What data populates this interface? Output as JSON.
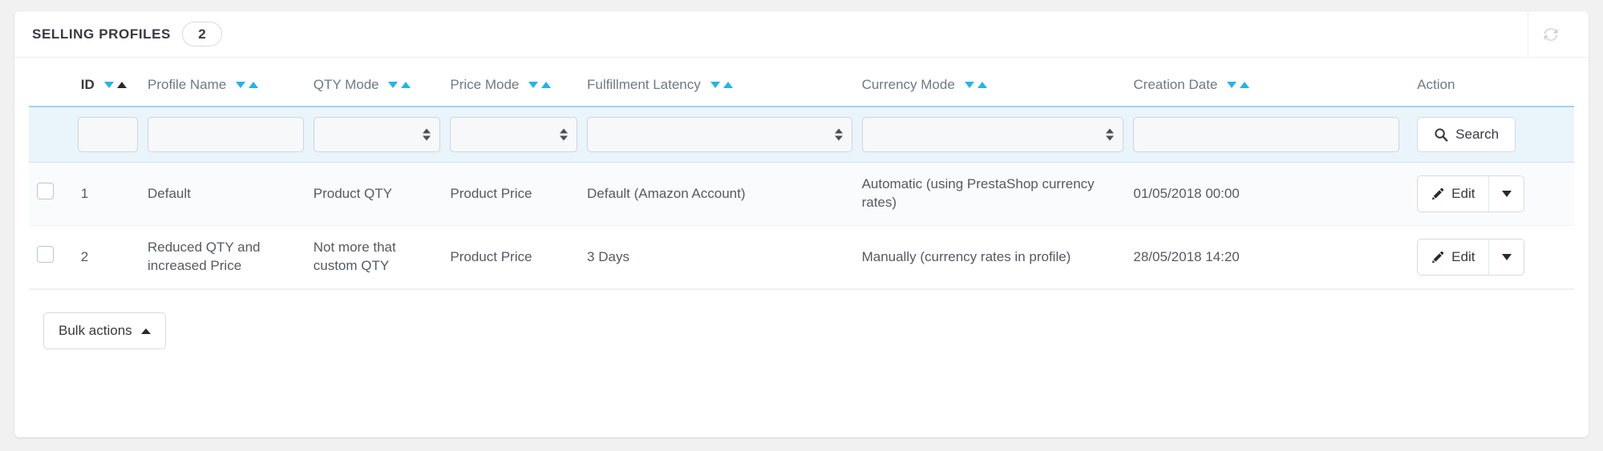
{
  "panel": {
    "title": "SELLING PROFILES",
    "count": "2",
    "refresh_icon": "refresh-icon"
  },
  "table": {
    "columns": [
      {
        "key": "checkbox",
        "label": "",
        "sortable": false
      },
      {
        "key": "id",
        "label": "ID",
        "sortable": true,
        "active_sort": "asc"
      },
      {
        "key": "profile_name",
        "label": "Profile Name",
        "sortable": true
      },
      {
        "key": "qty_mode",
        "label": "QTY Mode",
        "sortable": true
      },
      {
        "key": "price_mode",
        "label": "Price Mode",
        "sortable": true
      },
      {
        "key": "fulfillment_latency",
        "label": "Fulfillment Latency",
        "sortable": true
      },
      {
        "key": "currency_mode",
        "label": "Currency Mode",
        "sortable": true
      },
      {
        "key": "creation_date",
        "label": "Creation Date",
        "sortable": true
      },
      {
        "key": "action",
        "label": "Action",
        "sortable": false
      }
    ],
    "filters": {
      "id": {
        "type": "text",
        "value": "",
        "placeholder": ""
      },
      "profile_name": {
        "type": "text",
        "value": "",
        "placeholder": ""
      },
      "qty_mode": {
        "type": "select",
        "value": "",
        "options": [
          "",
          "Product QTY",
          "Not more that custom QTY"
        ]
      },
      "price_mode": {
        "type": "select",
        "value": "",
        "options": [
          "",
          "Product Price"
        ]
      },
      "fulfillment_latency": {
        "type": "select",
        "value": "",
        "options": [
          "",
          "Default (Amazon Account)",
          "3 Days"
        ]
      },
      "currency_mode": {
        "type": "select",
        "value": "",
        "options": [
          "",
          "Automatic (using PrestaShop currency rates)",
          "Manually (currency rates in profile)"
        ]
      },
      "creation_date": {
        "type": "text",
        "value": "",
        "placeholder": ""
      },
      "search_label": "Search",
      "search_icon": "search-icon"
    },
    "rows": [
      {
        "selected": false,
        "id": "1",
        "profile_name": "Default",
        "qty_mode": "Product QTY",
        "price_mode": "Product Price",
        "fulfillment_latency": "Default (Amazon Account)",
        "currency_mode": "Automatic (using PrestaShop currency rates)",
        "creation_date": "01/05/2018 00:00",
        "action_label": "Edit"
      },
      {
        "selected": false,
        "id": "2",
        "profile_name": "Reduced QTY and increased Price",
        "qty_mode": "Not more that custom QTY",
        "price_mode": "Product Price",
        "fulfillment_latency": "3 Days",
        "currency_mode": "Manually (currency rates in profile)",
        "creation_date": "28/05/2018 14:20",
        "action_label": "Edit"
      }
    ]
  },
  "footer": {
    "bulk_actions_label": "Bulk actions",
    "bulk_caret_icon": "caret-up-icon"
  },
  "colors": {
    "sort_arrow": "#23b4eb",
    "filter_row_bg": "#eaf4fb",
    "filter_row_border": "#9fd3ef",
    "text_primary": "#363a41",
    "text_secondary": "#6c7a84",
    "page_bg": "#f1f1f1"
  }
}
